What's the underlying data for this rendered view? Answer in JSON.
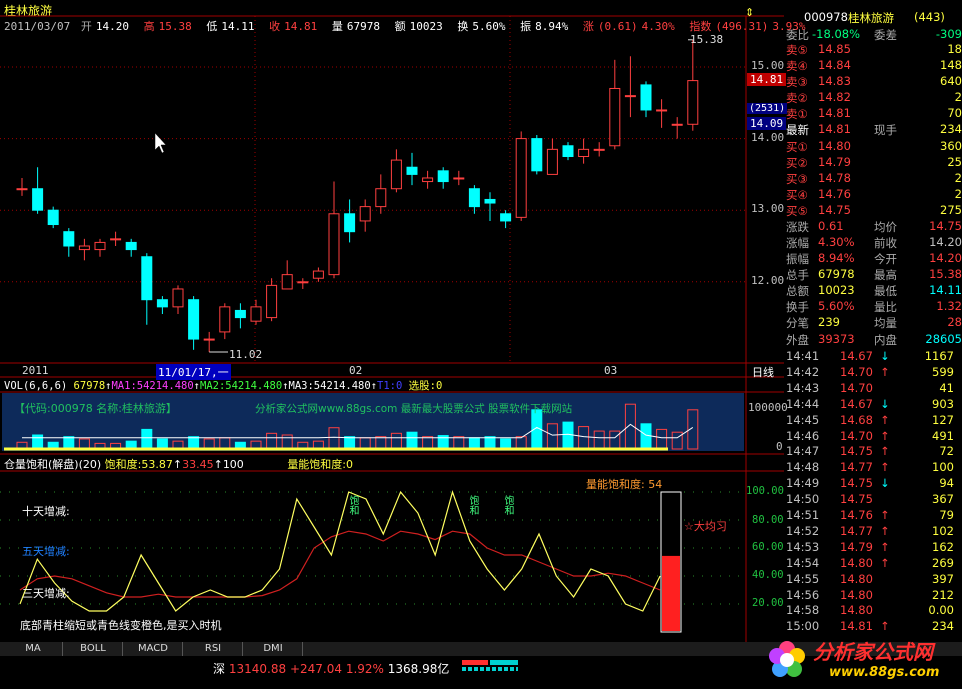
{
  "title": "桂林旅游",
  "quote_line": {
    "date": "2011/03/07",
    "open_label": "开",
    "open": "14.20",
    "high_label": "高",
    "high": "15.38",
    "low_label": "低",
    "low": "14.11",
    "close_label": "收",
    "close": "14.81",
    "volume_label": "量",
    "volume": "67978",
    "amount_label": "额",
    "amount": "10023",
    "turnover_label": "换",
    "turnover": "5.60%",
    "amplitude_label": "振",
    "amplitude": "8.94%",
    "change_label": "涨",
    "change": "(0.61)",
    "change_pct": "4.30%",
    "index_label": "指数",
    "index": "(496.31)",
    "index_pct": "3.93%"
  },
  "price_axis": [
    "15.00",
    "14.00",
    "13.00",
    "12.00"
  ],
  "price_tags": {
    "current": "14.81",
    "bid_count": "(2531)",
    "bid": "14.09"
  },
  "annotations": {
    "high_mark": "15.38",
    "low_mark": "11.02"
  },
  "time_axis": {
    "year": "2011",
    "cursor": "11/01/17,一",
    "feb": "02",
    "mar": "03",
    "period": "日线"
  },
  "volume_panel": {
    "header": {
      "name": "VOL(6,6,6)",
      "vol": "67978",
      "ma1": "MA1:54214.480",
      "ma2": "MA2:54214.480",
      "ma3": "MA3:54214.480",
      "t1": "T1:0",
      "pick": "选股:0"
    },
    "banner_left": "【代码:000978 名称:桂林旅游】",
    "banner_mid": "分析家公式网www.88gs.com 最新最大股票公式  股票软件下载网站",
    "axis": [
      "100000",
      "0"
    ]
  },
  "indicator_panel": {
    "header": {
      "name": "仓量饱和(解盘)(20)",
      "saturation": "饱和度:53.87",
      "v2": "33.45",
      "v3": "100",
      "vol_sat": "量能饱和度:0"
    },
    "labels": {
      "ten_day": "十天增减:",
      "five_day": "五天增减:",
      "three_day": "三天增减:",
      "tip": "底部青柱缩短或青色线变橙色,是买入时机"
    },
    "bar_label": "量能饱和度: 54",
    "bar_value": 54,
    "signal": "饱和",
    "right_mark": "大均习",
    "axis": [
      "100.00",
      "80.00",
      "60.00",
      "40.00",
      "20.00"
    ]
  },
  "right_panel": {
    "code": "000978",
    "name": "桂林旅游",
    "rank": "(443)",
    "ratio_label": "委比",
    "ratio": "-18.08%",
    "diff_label": "委差",
    "diff": "-309",
    "asks": [
      {
        "label": "卖⑤",
        "price": "14.85",
        "vol": "18"
      },
      {
        "label": "卖④",
        "price": "14.84",
        "vol": "148"
      },
      {
        "label": "卖③",
        "price": "14.83",
        "vol": "640"
      },
      {
        "label": "卖②",
        "price": "14.82",
        "vol": "2"
      },
      {
        "label": "卖①",
        "price": "14.81",
        "vol": "70"
      }
    ],
    "last": {
      "label": "最新",
      "price": "14.81",
      "label2": "现手",
      "vol": "234"
    },
    "bids": [
      {
        "label": "买①",
        "price": "14.80",
        "vol": "360"
      },
      {
        "label": "买②",
        "price": "14.79",
        "vol": "25"
      },
      {
        "label": "买③",
        "price": "14.78",
        "vol": "2"
      },
      {
        "label": "买④",
        "price": "14.76",
        "vol": "2"
      },
      {
        "label": "买⑤",
        "price": "14.75",
        "vol": "275"
      }
    ],
    "stats": [
      {
        "l1": "涨跌",
        "v1": "0.61",
        "l2": "均价",
        "v2": "14.75"
      },
      {
        "l1": "涨幅",
        "v1": "4.30%",
        "l2": "前收",
        "v2": "14.20"
      },
      {
        "l1": "振幅",
        "v1": "8.94%",
        "l2": "今开",
        "v2": "14.20"
      },
      {
        "l1": "总手",
        "v1": "67978",
        "l2": "最高",
        "v2": "15.38"
      },
      {
        "l1": "总额",
        "v1": "10023",
        "l2": "最低",
        "v2": "14.11"
      },
      {
        "l1": "换手",
        "v1": "5.60%",
        "l2": "量比",
        "v2": "1.32"
      },
      {
        "l1": "分笔",
        "v1": "239",
        "l2": "均量",
        "v2": "28"
      }
    ],
    "outer_label": "外盘",
    "outer": "39373",
    "inner_label": "内盘",
    "inner": "28605",
    "ticks": [
      {
        "t": "14:41",
        "p": "14.67",
        "d": "↓",
        "v": "1167"
      },
      {
        "t": "14:42",
        "p": "14.70",
        "d": "↑",
        "v": "599"
      },
      {
        "t": "14:43",
        "p": "14.70",
        "d": "",
        "v": "41"
      },
      {
        "t": "14:44",
        "p": "14.67",
        "d": "↓",
        "v": "903"
      },
      {
        "t": "14:45",
        "p": "14.68",
        "d": "↑",
        "v": "127"
      },
      {
        "t": "14:46",
        "p": "14.70",
        "d": "↑",
        "v": "491"
      },
      {
        "t": "14:47",
        "p": "14.75",
        "d": "↑",
        "v": "72"
      },
      {
        "t": "14:48",
        "p": "14.77",
        "d": "↑",
        "v": "100"
      },
      {
        "t": "14:49",
        "p": "14.75",
        "d": "↓",
        "v": "94"
      },
      {
        "t": "14:50",
        "p": "14.75",
        "d": "",
        "v": "367"
      },
      {
        "t": "14:51",
        "p": "14.76",
        "d": "↑",
        "v": "79"
      },
      {
        "t": "14:52",
        "p": "14.77",
        "d": "↑",
        "v": "102"
      },
      {
        "t": "14:53",
        "p": "14.79",
        "d": "↑",
        "v": "162"
      },
      {
        "t": "14:54",
        "p": "14.80",
        "d": "↑",
        "v": "269"
      },
      {
        "t": "14:55",
        "p": "14.80",
        "d": "",
        "v": "397"
      },
      {
        "t": "14:56",
        "p": "14.80",
        "d": "",
        "v": "212"
      },
      {
        "t": "14:58",
        "p": "14.80",
        "d": "",
        "v": "0.00"
      },
      {
        "t": "15:00",
        "p": "14.81",
        "d": "↑",
        "v": "234"
      }
    ]
  },
  "tabs": [
    "MA",
    "BOLL",
    "MACD",
    "RSI",
    "DMI"
  ],
  "status": {
    "market": "深",
    "index": "13140.88",
    "change": "+247.04",
    "pct": "1.92%",
    "amount": "1368.98亿"
  },
  "logo": {
    "text": "分析家公式网",
    "url": "www.88gs.com"
  },
  "colors": {
    "up": "#ff4040",
    "down": "#00ffff",
    "background": "#000000",
    "ma": "#ffffff",
    "warn": "#ffff40"
  },
  "chart_data": {
    "type": "candlestick",
    "title": "桂林旅游 日线",
    "ylim": [
      11.0,
      15.5
    ],
    "candles": [
      {
        "o": 13.3,
        "c": 13.3,
        "h": 13.45,
        "l": 13.2
      },
      {
        "o": 13.3,
        "c": 13.0,
        "h": 13.6,
        "l": 12.95
      },
      {
        "o": 13.0,
        "c": 12.8,
        "h": 13.05,
        "l": 12.75
      },
      {
        "o": 12.7,
        "c": 12.5,
        "h": 12.75,
        "l": 12.35
      },
      {
        "o": 12.45,
        "c": 12.5,
        "h": 12.6,
        "l": 12.3
      },
      {
        "o": 12.45,
        "c": 12.55,
        "h": 12.6,
        "l": 12.35
      },
      {
        "o": 12.6,
        "c": 12.6,
        "h": 12.7,
        "l": 12.5
      },
      {
        "o": 12.55,
        "c": 12.45,
        "h": 12.6,
        "l": 12.35
      },
      {
        "o": 12.35,
        "c": 11.75,
        "h": 12.4,
        "l": 11.4
      },
      {
        "o": 11.75,
        "c": 11.65,
        "h": 11.8,
        "l": 11.55
      },
      {
        "o": 11.65,
        "c": 11.9,
        "h": 11.95,
        "l": 11.55
      },
      {
        "o": 11.75,
        "c": 11.2,
        "h": 11.8,
        "l": 11.05
      },
      {
        "o": 11.2,
        "c": 11.2,
        "h": 11.3,
        "l": 11.02
      },
      {
        "o": 11.3,
        "c": 11.65,
        "h": 11.7,
        "l": 11.2
      },
      {
        "o": 11.6,
        "c": 11.5,
        "h": 11.7,
        "l": 11.35
      },
      {
        "o": 11.45,
        "c": 11.65,
        "h": 11.75,
        "l": 11.4
      },
      {
        "o": 11.5,
        "c": 11.95,
        "h": 12.05,
        "l": 11.45
      },
      {
        "o": 11.9,
        "c": 12.1,
        "h": 12.3,
        "l": 11.9
      },
      {
        "o": 12.0,
        "c": 12.0,
        "h": 12.05,
        "l": 11.9
      },
      {
        "o": 12.05,
        "c": 12.15,
        "h": 12.2,
        "l": 12.0
      },
      {
        "o": 12.1,
        "c": 12.95,
        "h": 13.4,
        "l": 12.05
      },
      {
        "o": 12.95,
        "c": 12.7,
        "h": 13.15,
        "l": 12.55
      },
      {
        "o": 12.85,
        "c": 13.05,
        "h": 13.15,
        "l": 12.7
      },
      {
        "o": 13.05,
        "c": 13.3,
        "h": 13.5,
        "l": 12.95
      },
      {
        "o": 13.3,
        "c": 13.7,
        "h": 13.85,
        "l": 13.25
      },
      {
        "o": 13.6,
        "c": 13.5,
        "h": 13.8,
        "l": 13.35
      },
      {
        "o": 13.4,
        "c": 13.45,
        "h": 13.55,
        "l": 13.3
      },
      {
        "o": 13.55,
        "c": 13.4,
        "h": 13.6,
        "l": 13.3
      },
      {
        "o": 13.45,
        "c": 13.45,
        "h": 13.55,
        "l": 13.35
      },
      {
        "o": 13.3,
        "c": 13.05,
        "h": 13.35,
        "l": 12.95
      },
      {
        "o": 13.15,
        "c": 13.1,
        "h": 13.25,
        "l": 12.85
      },
      {
        "o": 12.95,
        "c": 12.85,
        "h": 13.0,
        "l": 12.75
      },
      {
        "o": 12.9,
        "c": 14.0,
        "h": 14.1,
        "l": 12.85
      },
      {
        "o": 14.0,
        "c": 13.55,
        "h": 14.05,
        "l": 13.5
      },
      {
        "o": 13.5,
        "c": 13.85,
        "h": 14.0,
        "l": 13.5
      },
      {
        "o": 13.9,
        "c": 13.75,
        "h": 13.95,
        "l": 13.7
      },
      {
        "o": 13.75,
        "c": 13.85,
        "h": 14.0,
        "l": 13.65
      },
      {
        "o": 13.85,
        "c": 13.85,
        "h": 13.95,
        "l": 13.75
      },
      {
        "o": 13.9,
        "c": 14.7,
        "h": 15.1,
        "l": 13.85
      },
      {
        "o": 14.6,
        "c": 14.6,
        "h": 15.15,
        "l": 14.3
      },
      {
        "o": 14.75,
        "c": 14.4,
        "h": 14.8,
        "l": 14.3
      },
      {
        "o": 14.4,
        "c": 14.4,
        "h": 14.55,
        "l": 14.15
      },
      {
        "o": 14.2,
        "c": 14.2,
        "h": 14.3,
        "l": 14.0
      },
      {
        "o": 14.2,
        "c": 14.81,
        "h": 15.38,
        "l": 14.11
      }
    ],
    "volumes": [
      0.12,
      0.25,
      0.12,
      0.22,
      0.18,
      0.1,
      0.1,
      0.14,
      0.35,
      0.18,
      0.14,
      0.22,
      0.18,
      0.2,
      0.12,
      0.14,
      0.28,
      0.25,
      0.12,
      0.14,
      0.38,
      0.22,
      0.2,
      0.22,
      0.28,
      0.3,
      0.22,
      0.24,
      0.22,
      0.2,
      0.22,
      0.18,
      0.22,
      0.7,
      0.45,
      0.48,
      0.4,
      0.32,
      0.32,
      0.8,
      0.45,
      0.35,
      0.3,
      0.7
    ],
    "sat_yellow": [
      20,
      52,
      35,
      22,
      15,
      15,
      25,
      55,
      35,
      15,
      25,
      30,
      25,
      25,
      30,
      45,
      95,
      75,
      55,
      100,
      95,
      70,
      100,
      85,
      55,
      100,
      65,
      45,
      30,
      45,
      70,
      40,
      25,
      45,
      40,
      20,
      15,
      40
    ],
    "sat_red": [
      30,
      38,
      40,
      38,
      33,
      28,
      25,
      25,
      27,
      25,
      25,
      25,
      25,
      25,
      26,
      30,
      38,
      60,
      68,
      72,
      70,
      65,
      72,
      70,
      66,
      72,
      70,
      60,
      55,
      55,
      50,
      45,
      40,
      40,
      42,
      40,
      35,
      30
    ]
  }
}
